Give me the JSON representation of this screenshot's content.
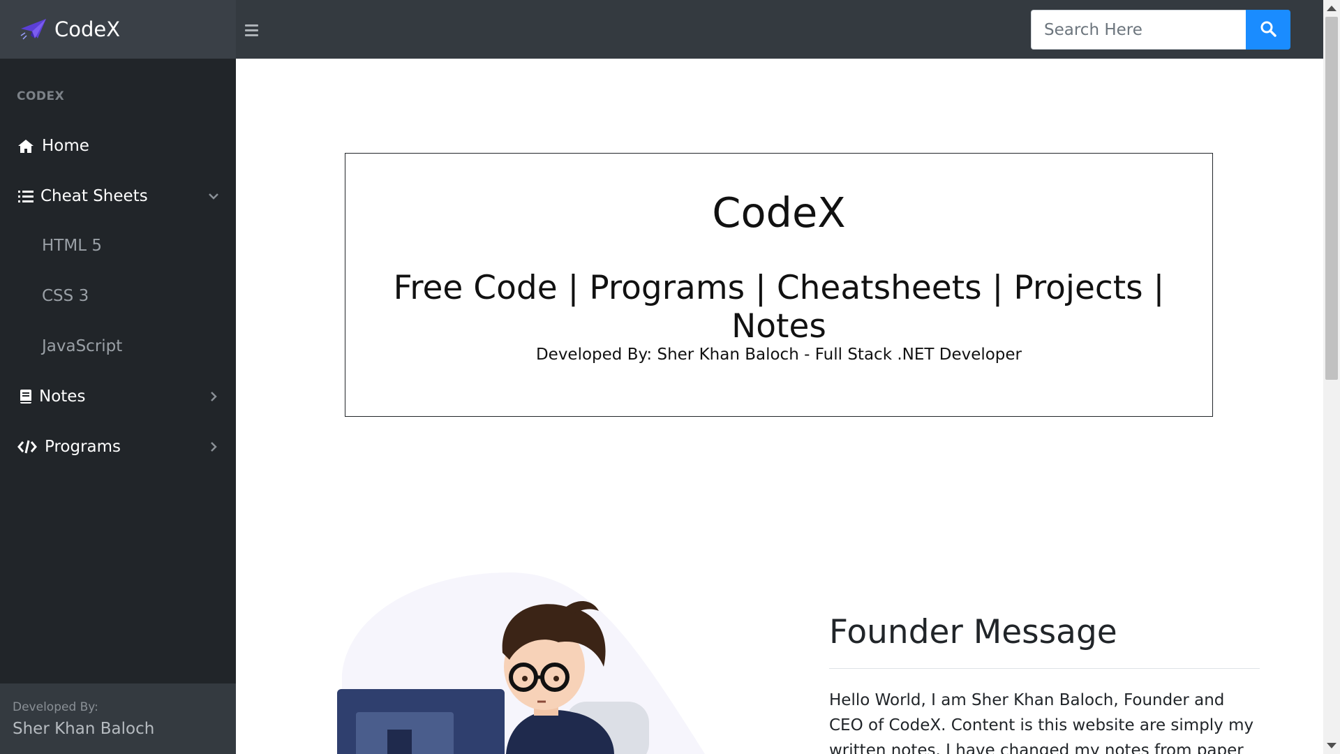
{
  "header": {
    "brand": "CodeX",
    "search": {
      "placeholder": "Search Here"
    }
  },
  "sidebar": {
    "heading": "CODEX",
    "items": [
      {
        "label": "Home",
        "icon": "home-icon"
      },
      {
        "label": "Cheat Sheets",
        "icon": "list-icon",
        "expanded": true,
        "children": [
          "HTML 5",
          "CSS 3",
          "JavaScript"
        ]
      },
      {
        "label": "Notes",
        "icon": "book-icon",
        "expanded": false
      },
      {
        "label": "Programs",
        "icon": "code-icon",
        "expanded": false
      }
    ],
    "footer": {
      "label": "Developed By:",
      "name": "Sher Khan Baloch"
    }
  },
  "hero": {
    "title": "CodeX",
    "tagline": "Free Code | Programs | Cheatsheets | Projects | Notes",
    "credit": "Developed By: Sher Khan Baloch - Full Stack .NET Developer"
  },
  "founder": {
    "title": "Founder Message",
    "text": "Hello World, I am Sher Khan Baloch, Founder and CEO of CodeX. Content is this website are simply my written notes. I have changed my notes from paper into this"
  },
  "colors": {
    "topbar": "#343a40",
    "sidebar": "#212529",
    "accent": "#1a8cff",
    "logo": "#5b3fd6"
  }
}
